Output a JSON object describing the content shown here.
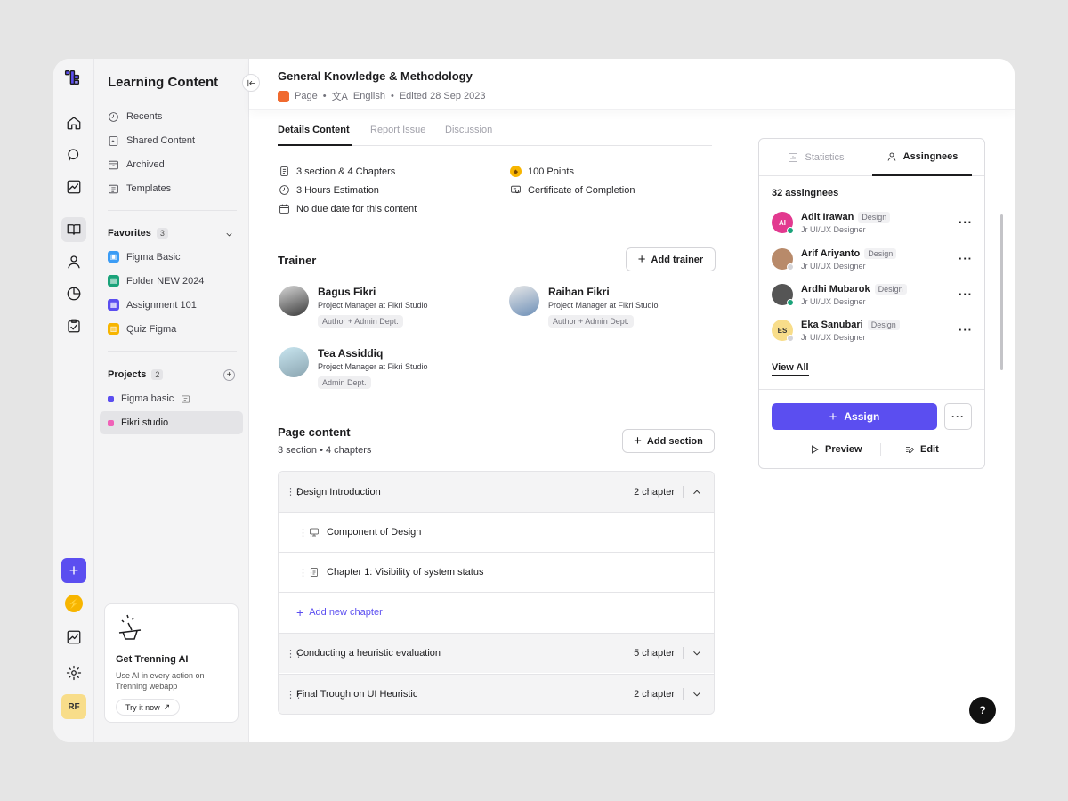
{
  "sidebar": {
    "title": "Learning Content",
    "nav": [
      {
        "label": "Recents",
        "icon": "clock-icon"
      },
      {
        "label": "Shared Content",
        "icon": "shared-icon"
      },
      {
        "label": "Archived",
        "icon": "archive-icon"
      },
      {
        "label": "Templates",
        "icon": "template-icon"
      }
    ],
    "favorites": {
      "label": "Favorites",
      "count": "3",
      "items": [
        {
          "label": "Figma Basic",
          "color": "#3b9cf5"
        },
        {
          "label": "Folder NEW 2024",
          "color": "#1aa37a"
        },
        {
          "label": "Assignment 101",
          "color": "#5b4ef0"
        },
        {
          "label": "Quiz Figma",
          "color": "#f7b500"
        }
      ]
    },
    "projects": {
      "label": "Projects",
      "count": "2",
      "items": [
        {
          "label": "Figma basic",
          "color": "#5b4ef0"
        },
        {
          "label": "Fikri studio",
          "color": "#f062b8"
        }
      ]
    },
    "ai_card": {
      "title": "Get Trenning AI",
      "desc": "Use AI in every action on Trenning webapp",
      "cta": "Try it now"
    }
  },
  "rail": {
    "avatar_initials": "RF"
  },
  "header": {
    "title": "General Knowledge & Methodology",
    "type": "Page",
    "language": "English",
    "edited": "Edited 28 Sep 2023"
  },
  "tabs": [
    "Details Content",
    "Report Issue",
    "Discussion"
  ],
  "details": {
    "sections": "3 section & 4 Chapters",
    "hours": "3 Hours Estimation",
    "due": "No due date for this content",
    "points": "100 Points",
    "certificate": "Certificate of Completion"
  },
  "trainer": {
    "title": "Trainer",
    "add_label": "Add trainer",
    "people": [
      {
        "name": "Bagus Fikri",
        "role": "Project Manager at Fikri Studio",
        "tag": "Author + Admin Dept."
      },
      {
        "name": "Raihan Fikri",
        "role": "Project Manager at Fikri Studio",
        "tag": "Author + Admin Dept."
      },
      {
        "name": "Tea Assiddiq",
        "role": "Project Manager at Fikri Studio",
        "tag": "Admin Dept."
      }
    ]
  },
  "page_content": {
    "title": "Page content",
    "subtitle": "3 section • 4 chapters",
    "add_label": "Add section",
    "sections": [
      {
        "title": "Design Introduction",
        "chapters": "2 chapter"
      },
      {
        "title": "Conducting a heuristic evaluation",
        "chapters": "5 chapter"
      },
      {
        "title": "Final Trough on UI Heuristic",
        "chapters": "2 chapter"
      }
    ],
    "items": [
      "Component of Design",
      "Chapter 1: Visibility of system status"
    ],
    "add_chapter": "Add new chapter"
  },
  "panel": {
    "tabs": [
      "Statistics",
      "Assingnees"
    ],
    "count": "32 assingnees",
    "assignees": [
      {
        "initials": "AI",
        "name": "Adit Irawan",
        "dept": "Design",
        "role": "Jr UI/UX Designer",
        "color": "#e2398f",
        "status": "#1aa37a"
      },
      {
        "initials": "",
        "name": "Arif Ariyanto",
        "dept": "Design",
        "role": "Jr UI/UX Designer",
        "color": "#b88a6a",
        "status": "#d4d4d8"
      },
      {
        "initials": "",
        "name": "Ardhi Mubarok",
        "dept": "Design",
        "role": "Jr UI/UX Designer",
        "color": "#555555",
        "status": "#1aa37a"
      },
      {
        "initials": "ES",
        "name": "Eka Sanubari",
        "dept": "Design",
        "role": "Jr UI/UX Designer",
        "color": "#f8dd8a",
        "status": "#d4d4d8"
      }
    ],
    "view_all": "View All",
    "assign": "Assign",
    "preview": "Preview",
    "edit": "Edit"
  },
  "help": "?"
}
